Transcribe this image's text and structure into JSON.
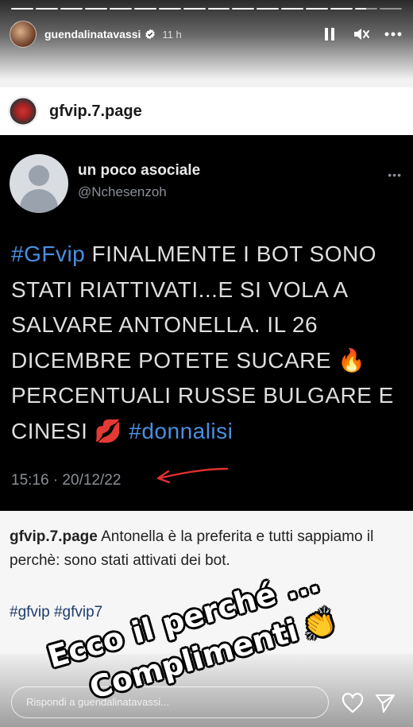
{
  "progress": {
    "segments": 16,
    "completed": 14,
    "current_fraction": 0.5
  },
  "header": {
    "username": "guendalinatavassi",
    "time": "11 h",
    "icons": [
      "pause-icon",
      "mute-icon",
      "more-icon"
    ]
  },
  "post": {
    "handle": "gfvip.7.page"
  },
  "tweet": {
    "name": "un poco asociale",
    "username": "@Nchesenzoh",
    "more": "•••",
    "text_hashtag": "#GFvip",
    "text_main": " FINALMENTE I BOT SONO STATI RIATTIVATI...E SI VOLA A SALVARE ANTONELLA. IL 26 DICEMBRE POTETE SUCARE 🔥 PERCENTUALI RUSSE BULGARE E CINESI 💋 ",
    "text_hashtag2": "#donnalisi",
    "timestamp": "15:16 · 20/12/22"
  },
  "caption": {
    "handle": "gfvip.7.page",
    "text": " Antonella è la preferita e tutti sappiamo il perchè: sono stati attivati dei bot.",
    "tags": "#gfvip #gfvip7"
  },
  "overlay": {
    "line1": "Ecco il perché ...",
    "line2": "Complimenti",
    "emoji": "👏"
  },
  "reply": {
    "placeholder": "Rispondi a guendalinatavassi..."
  },
  "colors": {
    "hashtag": "#4a8fe0",
    "arrow": "#e03030"
  }
}
